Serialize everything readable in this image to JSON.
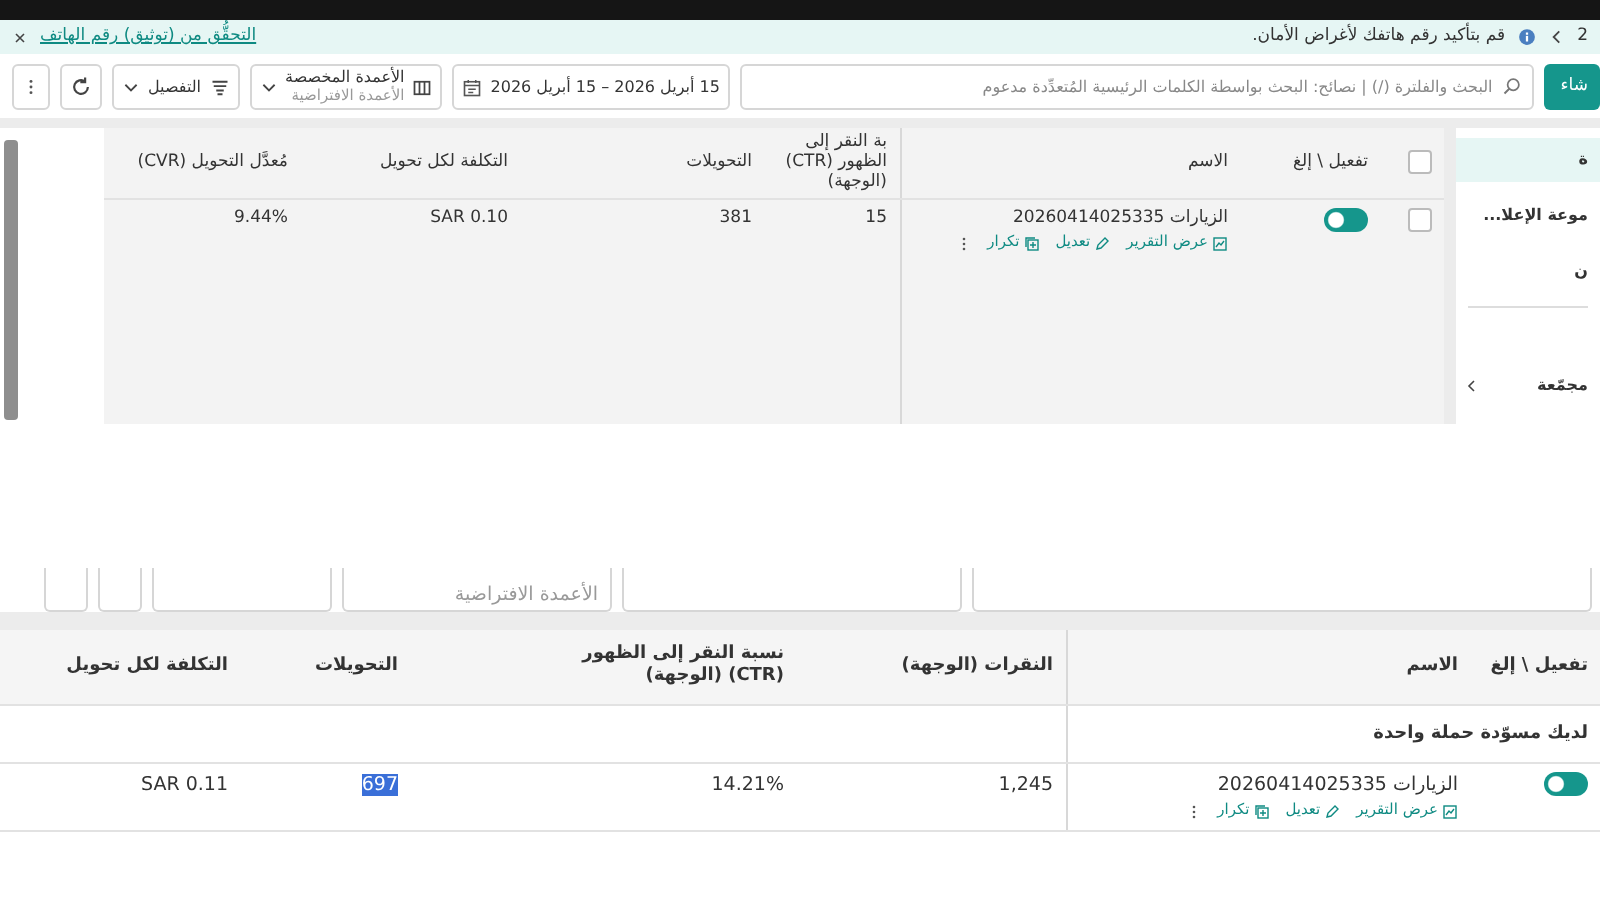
{
  "notice": {
    "page": "2",
    "message": "قم بتأكيد رقم هاتفك لأغراض الأمان.",
    "link": "التحقُّق من (توثيق) رقم الهاتف"
  },
  "top_panel": {
    "toolbar": {
      "create_button": "شاء",
      "search": {
        "placeholder": "البحث والفلترة (/) | نصائح: البحث بواسطة الكلمات الرئيسية المُتعدِّدة مدعوم"
      },
      "date_range": "15 أبريل 2026 – 15 أبريل 2026",
      "columns": {
        "label": "الأعمدة المخصصة",
        "sublabel": "الأعمدة الافتراضية"
      },
      "breakdown": "التفصيل"
    },
    "sidebar": {
      "items": [
        {
          "label": "ة",
          "selected": true,
          "expandable": false
        },
        {
          "label": "موعة الإعلا...",
          "selected": false,
          "expandable": false
        },
        {
          "label": "ن",
          "selected": false,
          "expandable": false
        },
        {
          "label": "مجمّعة",
          "selected": false,
          "expandable": true
        }
      ]
    },
    "table": {
      "header_checked": false,
      "fixed_columns": [
        "تفعيل \\ إلغ",
        "الاسم"
      ],
      "columns": [
        "بة النقر إلى الظهور (CTR) (الوجهة)",
        "التحويلات",
        "التكلفة لكل تحويل",
        "مُعدَّل التحويل (CVR)"
      ],
      "rows": [
        {
          "checked": false,
          "on": true,
          "name": "الزيارات 20260414025335",
          "actions": [
            "عرض التقرير",
            "تعديل",
            "تكرار"
          ],
          "cells": [
            {
              "text": "15",
              "highlighted": false
            },
            {
              "text": "381",
              "highlighted": false
            },
            {
              "text": "SAR 0.10",
              "highlighted": false
            },
            {
              "text": "9.44%",
              "highlighted": false
            }
          ]
        }
      ]
    }
  },
  "bottom_panel": {
    "toolbar": {
      "columns_sublabel": "الأعمدة الافتراضية"
    },
    "table": {
      "fixed_columns": [
        "تفعيل \\ إلغ",
        "الاسم"
      ],
      "columns": [
        "النقرات (الوجهة)",
        "نسبة النقر إلى الظهور (CTR) (الوجهة)",
        "التحويلات",
        "التكلفة لكل تحويل"
      ],
      "draft_notice": "لديك مسوّدة حملة واحدة",
      "rows": [
        {
          "on": true,
          "name": "الزيارات 20260414025335",
          "actions": [
            "عرض التقرير",
            "تعديل",
            "تكرار"
          ],
          "cells": [
            {
              "text": "1,245",
              "highlighted": false
            },
            {
              "text": "14.21%",
              "highlighted": false
            },
            {
              "text": "697",
              "highlighted": true
            },
            {
              "text": "SAR 0.11",
              "highlighted": false
            }
          ]
        }
      ]
    }
  }
}
